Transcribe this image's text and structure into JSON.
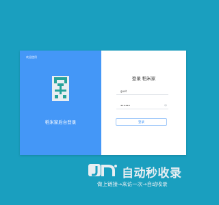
{
  "login": {
    "welcome_text": "欢迎使用",
    "left_title": "稻米家后台登录",
    "right_title": "登录 稻米家",
    "username_value": "guet",
    "password_value": "••••••",
    "submit_label": "登录",
    "accent_color": "#4497f7"
  },
  "watermark": {
    "title": "自动秒收录",
    "subtitle": "做上链接→来访一次→自动收录"
  }
}
